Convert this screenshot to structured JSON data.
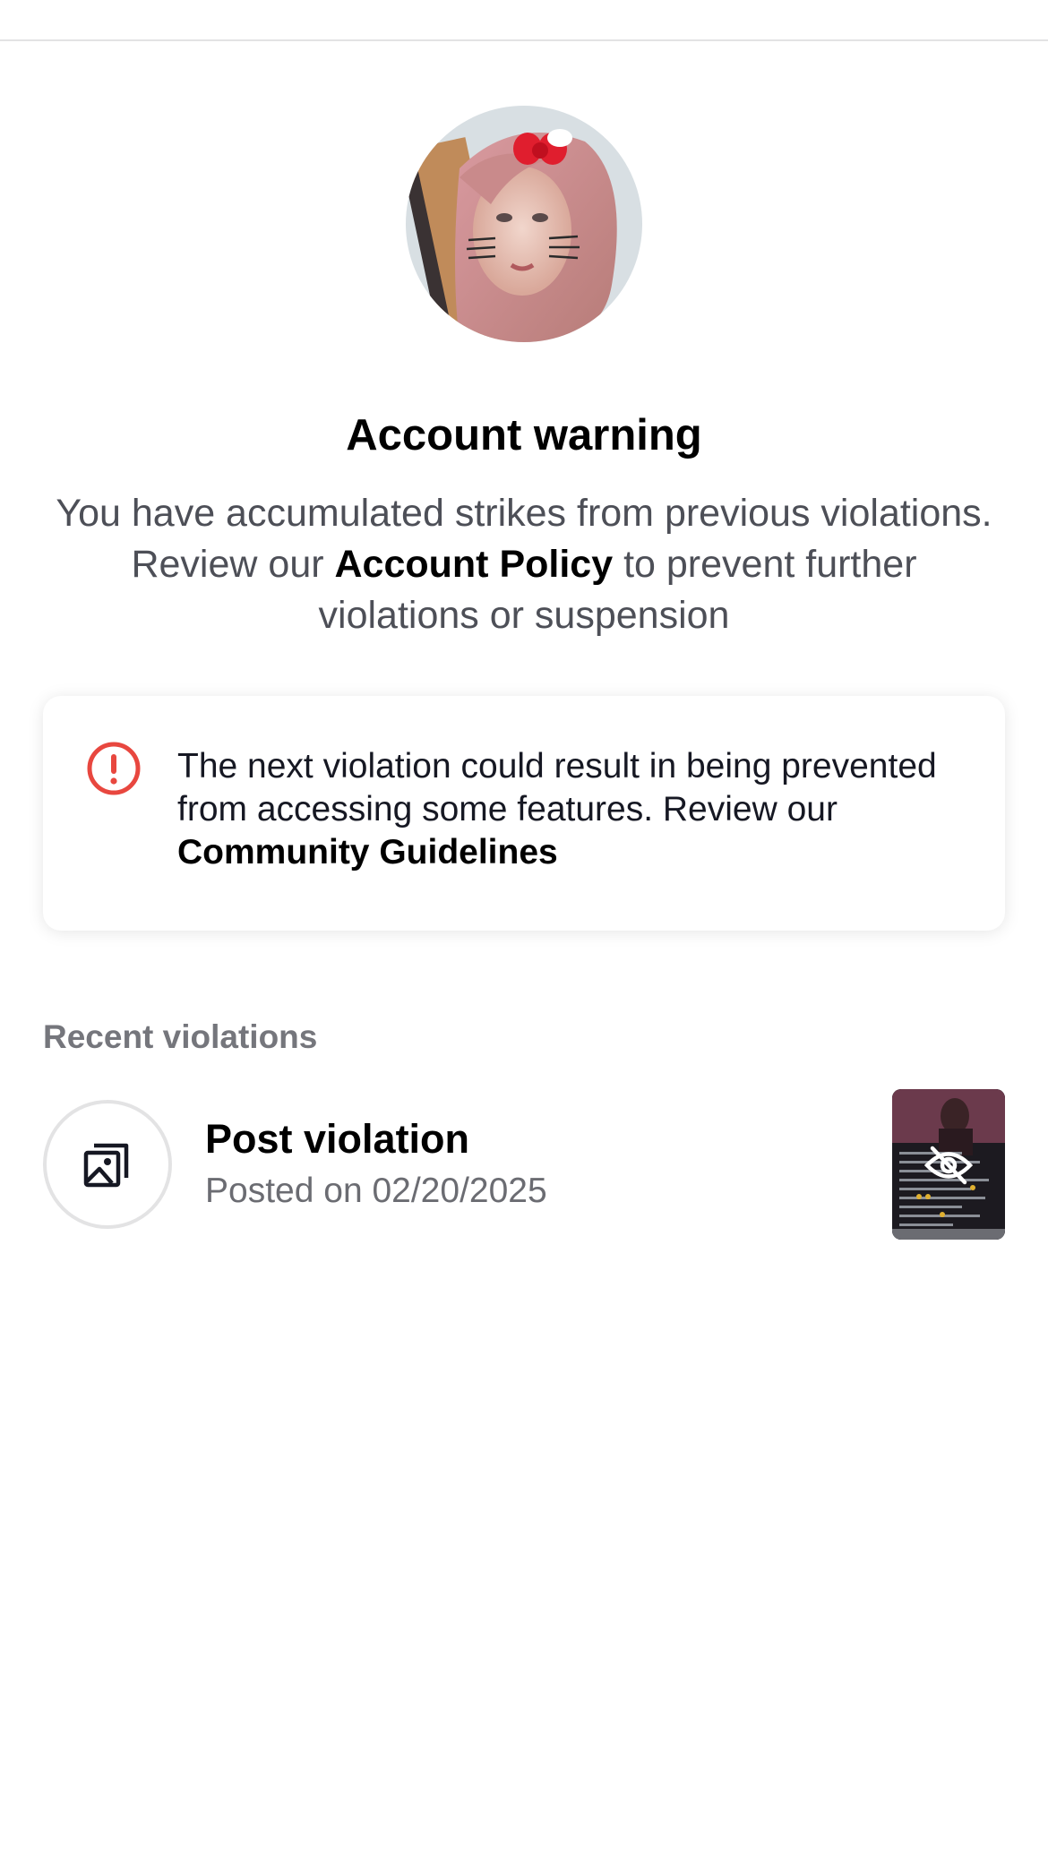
{
  "header": {
    "back_icon": "chevron-left-icon"
  },
  "account": {
    "avatar_icon": "profile-avatar"
  },
  "warning": {
    "title": "Account warning",
    "desc_part1": "You have accumulated strikes from previous violations. Review our ",
    "desc_link": "Account Policy",
    "desc_part2": " to prevent further violations or suspension"
  },
  "notice": {
    "icon": "alert-circle-icon",
    "accent_color": "#e8473f",
    "text_part1": "The next violation could result in being prevented from accessing some features. Review our ",
    "link": "Community Guidelines"
  },
  "recent": {
    "label": "Recent violations",
    "items": [
      {
        "icon": "gallery-icon",
        "title": "Post violation",
        "subtitle": "Posted on 02/20/2025",
        "thumb_icon": "eye-off-icon"
      }
    ]
  }
}
